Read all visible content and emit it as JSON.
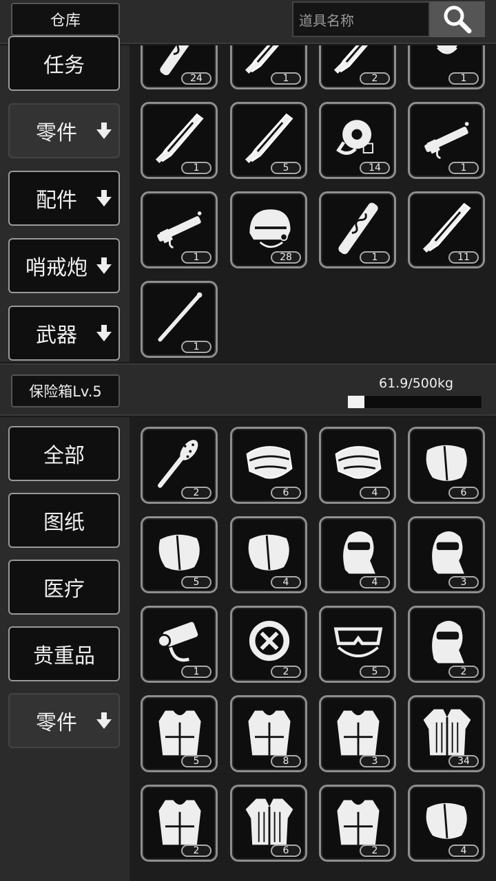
{
  "header": {
    "warehouse_tab": "仓库",
    "search_placeholder": "道具名称"
  },
  "warehouse": {
    "categories": [
      {
        "label": "任务",
        "arrow": false,
        "active": false
      },
      {
        "label": "零件",
        "arrow": true,
        "active": true
      },
      {
        "label": "配件",
        "arrow": true,
        "active": false
      },
      {
        "label": "哨戒炮",
        "arrow": true,
        "active": false
      },
      {
        "label": "武器",
        "arrow": true,
        "active": false
      }
    ],
    "items": [
      {
        "icon": "bone-blade-icon",
        "count": "24"
      },
      {
        "icon": "sword-icon",
        "count": "1"
      },
      {
        "icon": "dagger-icon",
        "count": "2"
      },
      {
        "icon": "gear-part-icon",
        "count": "1"
      },
      {
        "icon": "feather-blade-icon",
        "count": "1"
      },
      {
        "icon": "spear-tip-icon",
        "count": "5"
      },
      {
        "icon": "circular-saw-icon",
        "count": "14"
      },
      {
        "icon": "nail-gun-icon",
        "count": "1"
      },
      {
        "icon": "rifle-part-icon",
        "count": "1"
      },
      {
        "icon": "helmet-icon",
        "count": "28"
      },
      {
        "icon": "carved-staff-icon",
        "count": "1"
      },
      {
        "icon": "machete-icon",
        "count": "11"
      },
      {
        "icon": "metal-rod-icon",
        "count": "1"
      }
    ]
  },
  "safebox": {
    "title": "保险箱Lv.5",
    "weight_text": "61.9/500kg",
    "weight_fraction": 0.124,
    "categories": [
      {
        "label": "全部",
        "arrow": false,
        "active": false
      },
      {
        "label": "图纸",
        "arrow": false,
        "active": false
      },
      {
        "label": "医疗",
        "arrow": false,
        "active": false
      },
      {
        "label": "贵重品",
        "arrow": false,
        "active": false
      },
      {
        "label": "零件",
        "arrow": true,
        "active": true
      }
    ],
    "items": [
      {
        "icon": "spiked-club-icon",
        "count": "2"
      },
      {
        "icon": "mesh-armor-icon",
        "count": "6"
      },
      {
        "icon": "leaf-armor-icon",
        "count": "4"
      },
      {
        "icon": "shoulder-pad-icon",
        "count": "6"
      },
      {
        "icon": "studded-pad-icon",
        "count": "5"
      },
      {
        "icon": "plated-pad-icon",
        "count": "4"
      },
      {
        "icon": "padded-hood-icon",
        "count": "4"
      },
      {
        "icon": "tactical-helmet-icon",
        "count": "3"
      },
      {
        "icon": "camera-rig-icon",
        "count": "1"
      },
      {
        "icon": "lifebuoy-icon",
        "count": "2"
      },
      {
        "icon": "goggles-icon",
        "count": "5"
      },
      {
        "icon": "balaclava-icon",
        "count": "2"
      },
      {
        "icon": "plate-carrier-icon",
        "count": "5"
      },
      {
        "icon": "light-vest-icon",
        "count": "8"
      },
      {
        "icon": "white-vest-icon",
        "count": "3"
      },
      {
        "icon": "striped-jacket-icon",
        "count": "34"
      },
      {
        "icon": "utility-vest-icon",
        "count": "2"
      },
      {
        "icon": "short-jacket-icon",
        "count": "6"
      },
      {
        "icon": "tactical-vest-icon",
        "count": "2"
      },
      {
        "icon": "knee-pad-icon",
        "count": "4"
      }
    ]
  }
}
